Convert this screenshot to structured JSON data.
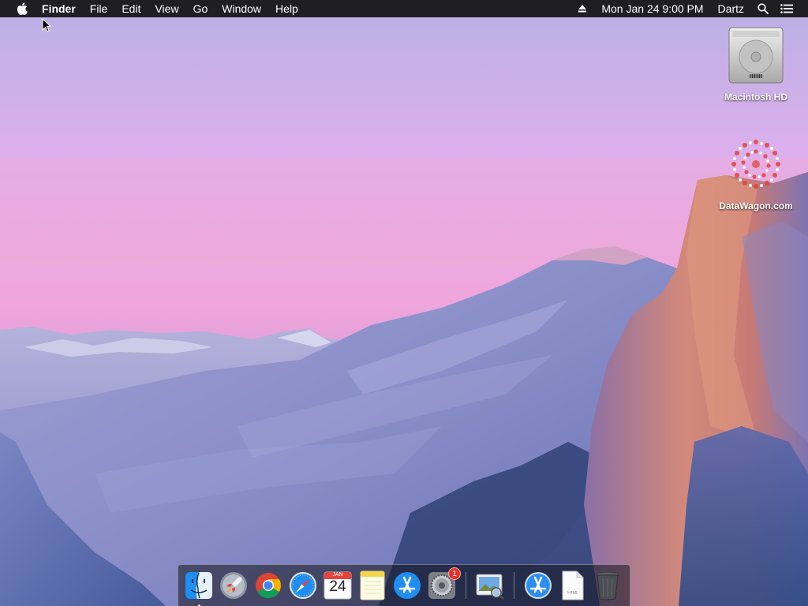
{
  "menubar": {
    "app_name": "Finder",
    "menus": [
      "File",
      "Edit",
      "View",
      "Go",
      "Window",
      "Help"
    ],
    "clock": "Mon Jan 24  9:00 PM",
    "user": "Dartz",
    "icons": [
      "apple-icon",
      "eject-icon",
      "spotlight-search-icon",
      "notification-center-icon"
    ]
  },
  "desktop": {
    "items": [
      {
        "label": "Macintosh HD",
        "icon": "hard-drive-icon"
      },
      {
        "label": "DataWagon.com",
        "icon": "network-volume-icon"
      }
    ]
  },
  "dock": {
    "apps": [
      {
        "name": "Finder",
        "icon": "finder-icon",
        "running": true
      },
      {
        "name": "Launchpad",
        "icon": "launchpad-icon"
      },
      {
        "name": "Google Chrome",
        "icon": "chrome-icon"
      },
      {
        "name": "Safari",
        "icon": "safari-icon"
      },
      {
        "name": "Calendar",
        "icon": "calendar-icon",
        "month": "JAN",
        "day": "24"
      },
      {
        "name": "Notes",
        "icon": "notes-icon"
      },
      {
        "name": "App Store",
        "icon": "app-store-icon"
      },
      {
        "name": "System Preferences",
        "icon": "system-preferences-icon",
        "badge": "1"
      },
      {
        "name": "Preview",
        "icon": "preview-icon"
      },
      {
        "name": "Applications",
        "icon": "applications-folder-icon"
      },
      {
        "name": "Document",
        "icon": "html-document-icon",
        "doc_label": "HTML"
      },
      {
        "name": "Trash",
        "icon": "trash-icon"
      }
    ]
  },
  "colors": {
    "menubar_bg": "#1f1f22",
    "sky_top": "#d6b0ea",
    "sky_mid": "#f1a6d9",
    "mountain": "#7d84bf",
    "cliff": "#c98679",
    "badge": "#e4312b"
  }
}
